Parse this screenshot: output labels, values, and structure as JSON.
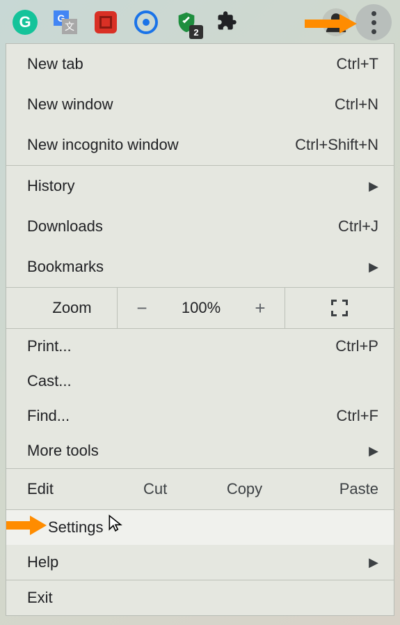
{
  "toolbar": {
    "grammarly_letter": "G",
    "gtranslate_left": "G",
    "gtranslate_right": "文",
    "shield_badge": "2"
  },
  "menu": {
    "new_tab": {
      "label": "New tab",
      "shortcut": "Ctrl+T"
    },
    "new_window": {
      "label": "New window",
      "shortcut": "Ctrl+N"
    },
    "new_incognito": {
      "label": "New incognito window",
      "shortcut": "Ctrl+Shift+N"
    },
    "history": {
      "label": "History"
    },
    "downloads": {
      "label": "Downloads",
      "shortcut": "Ctrl+J"
    },
    "bookmarks": {
      "label": "Bookmarks"
    },
    "zoom": {
      "label": "Zoom",
      "minus": "−",
      "value": "100%",
      "plus": "+"
    },
    "print": {
      "label": "Print...",
      "shortcut": "Ctrl+P"
    },
    "cast": {
      "label": "Cast..."
    },
    "find": {
      "label": "Find...",
      "shortcut": "Ctrl+F"
    },
    "more_tools": {
      "label": "More tools"
    },
    "edit": {
      "label": "Edit",
      "cut": "Cut",
      "copy": "Copy",
      "paste": "Paste"
    },
    "settings": {
      "label": "Settings"
    },
    "help": {
      "label": "Help"
    },
    "exit": {
      "label": "Exit"
    }
  }
}
